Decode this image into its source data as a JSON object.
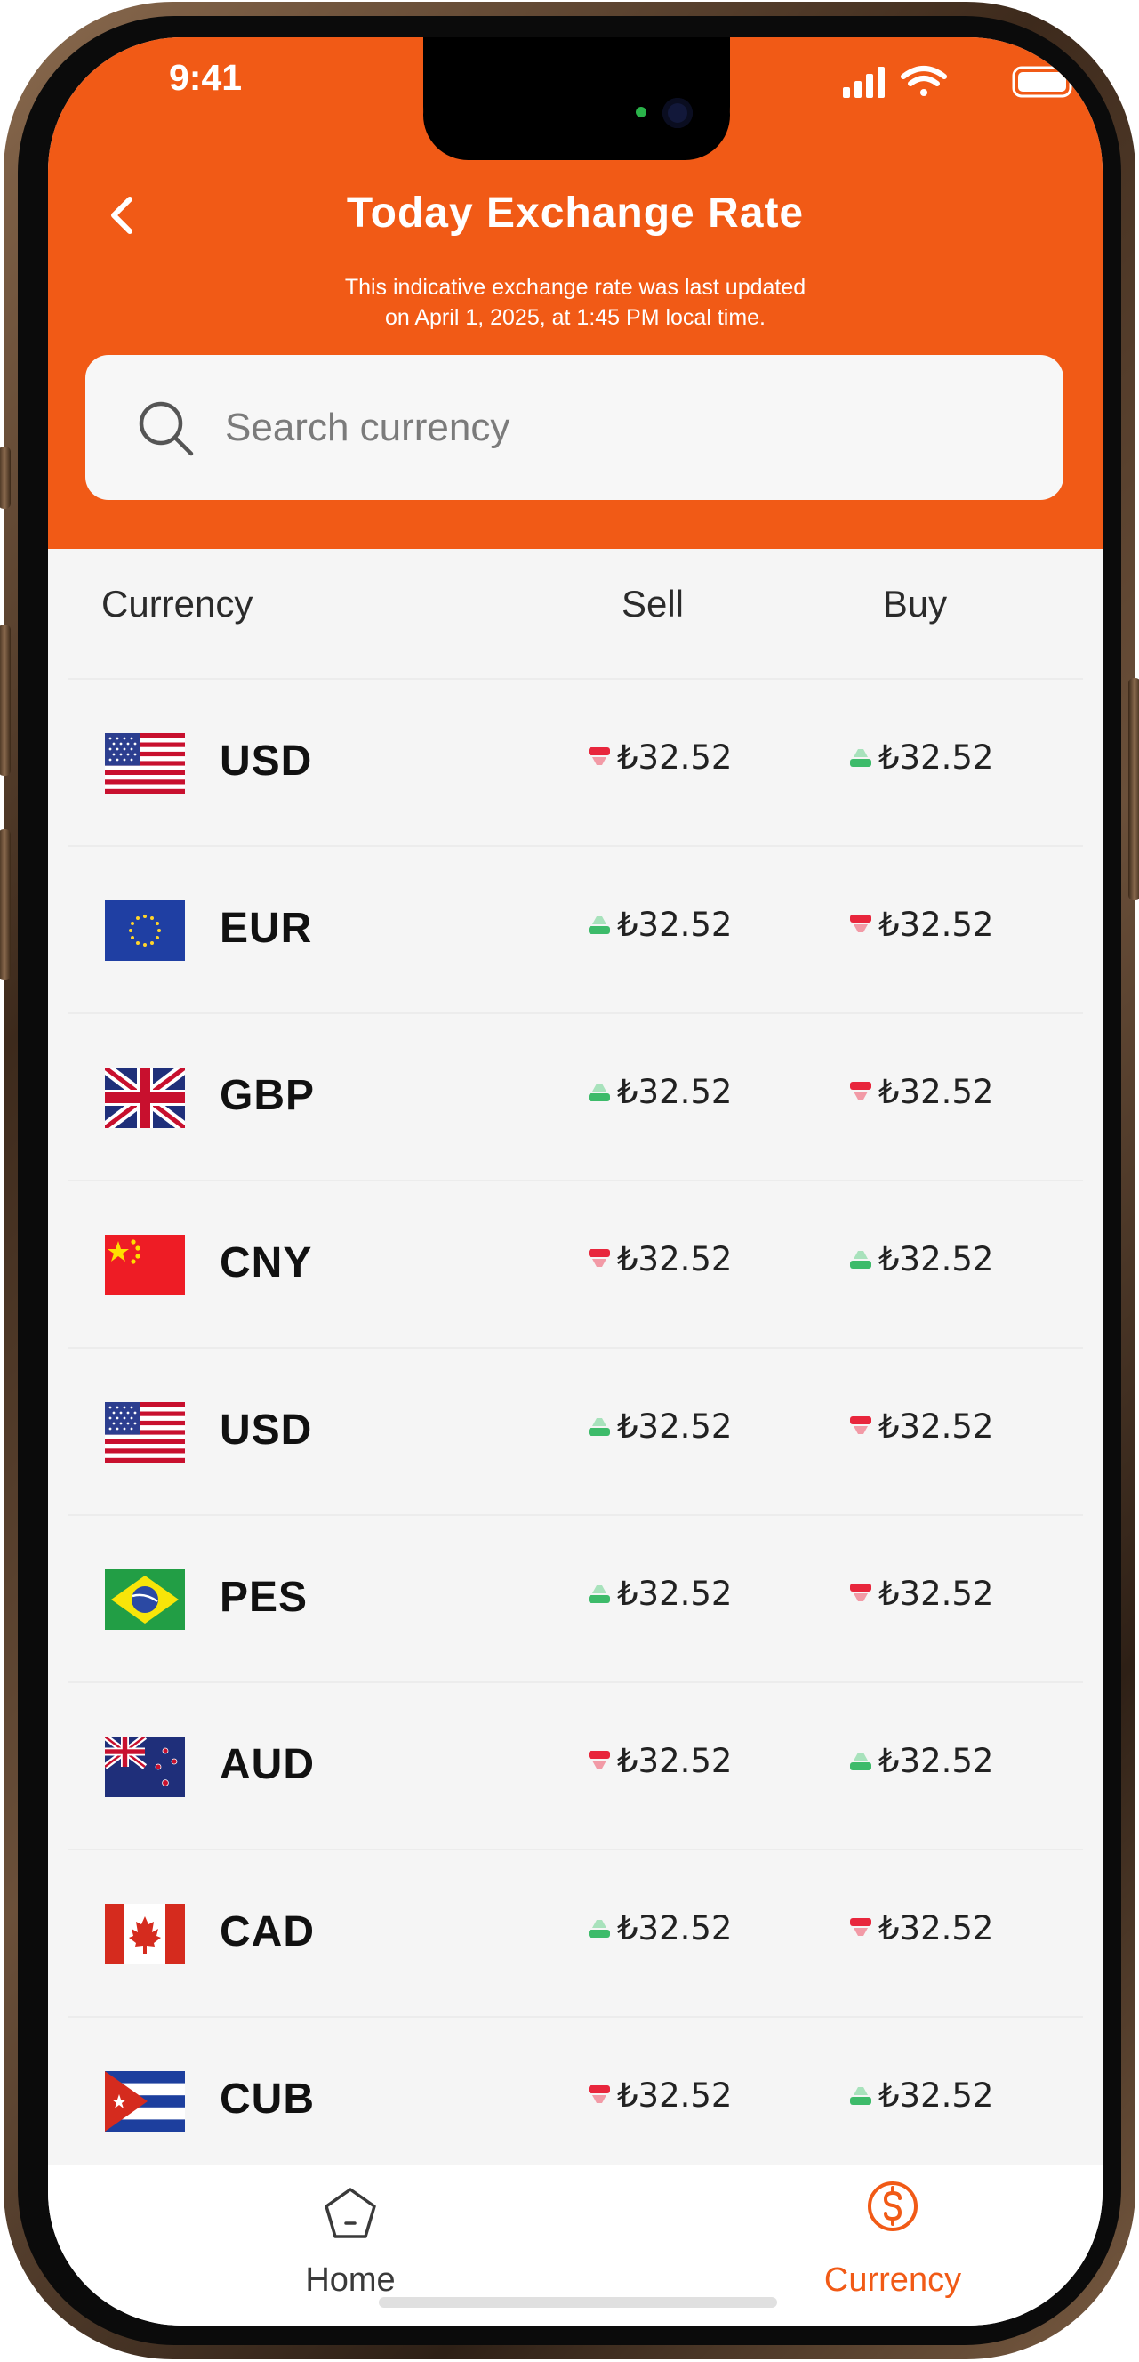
{
  "status_bar": {
    "time": "9:41"
  },
  "header": {
    "title": "Today Exchange Rate",
    "subtitle_line1": "This indicative exchange rate was last updated",
    "subtitle_line2": "on April 1, 2025, at 1:45 PM local time.",
    "accent_color": "#f15a16"
  },
  "search": {
    "placeholder": "Search currency",
    "value": ""
  },
  "table": {
    "columns": {
      "currency": "Currency",
      "sell": "Sell",
      "buy": "Buy"
    },
    "rows": [
      {
        "flag": "us-flag",
        "code": "USD",
        "sell": "₺32.52",
        "sell_trend": "down",
        "buy": "₺32.52",
        "buy_trend": "up"
      },
      {
        "flag": "eu-flag",
        "code": "EUR",
        "sell": "₺32.52",
        "sell_trend": "up",
        "buy": "₺32.52",
        "buy_trend": "down"
      },
      {
        "flag": "uk-flag",
        "code": "GBP",
        "sell": "₺32.52",
        "sell_trend": "up",
        "buy": "₺32.52",
        "buy_trend": "down"
      },
      {
        "flag": "cn-flag",
        "code": "CNY",
        "sell": "₺32.52",
        "sell_trend": "down",
        "buy": "₺32.52",
        "buy_trend": "up"
      },
      {
        "flag": "us-flag",
        "code": "USD",
        "sell": "₺32.52",
        "sell_trend": "up",
        "buy": "₺32.52",
        "buy_trend": "down"
      },
      {
        "flag": "br-flag",
        "code": "PES",
        "sell": "₺32.52",
        "sell_trend": "up",
        "buy": "₺32.52",
        "buy_trend": "down"
      },
      {
        "flag": "nz-flag",
        "code": "AUD",
        "sell": "₺32.52",
        "sell_trend": "down",
        "buy": "₺32.52",
        "buy_trend": "up"
      },
      {
        "flag": "ca-flag",
        "code": "CAD",
        "sell": "₺32.52",
        "sell_trend": "up",
        "buy": "₺32.52",
        "buy_trend": "down"
      },
      {
        "flag": "cu-flag",
        "code": "CUB",
        "sell": "₺32.52",
        "sell_trend": "down",
        "buy": "₺32.52",
        "buy_trend": "up"
      }
    ],
    "trend_colors": {
      "up": "#3dbb6a",
      "down": "#e8263c"
    }
  },
  "tab_bar": {
    "tabs": [
      {
        "label": "Home",
        "icon": "home-icon",
        "active": false
      },
      {
        "label": "Currency",
        "icon": "currency-icon",
        "active": true
      }
    ],
    "active_color": "#f15a16",
    "inactive_color": "#3a3a3a"
  }
}
